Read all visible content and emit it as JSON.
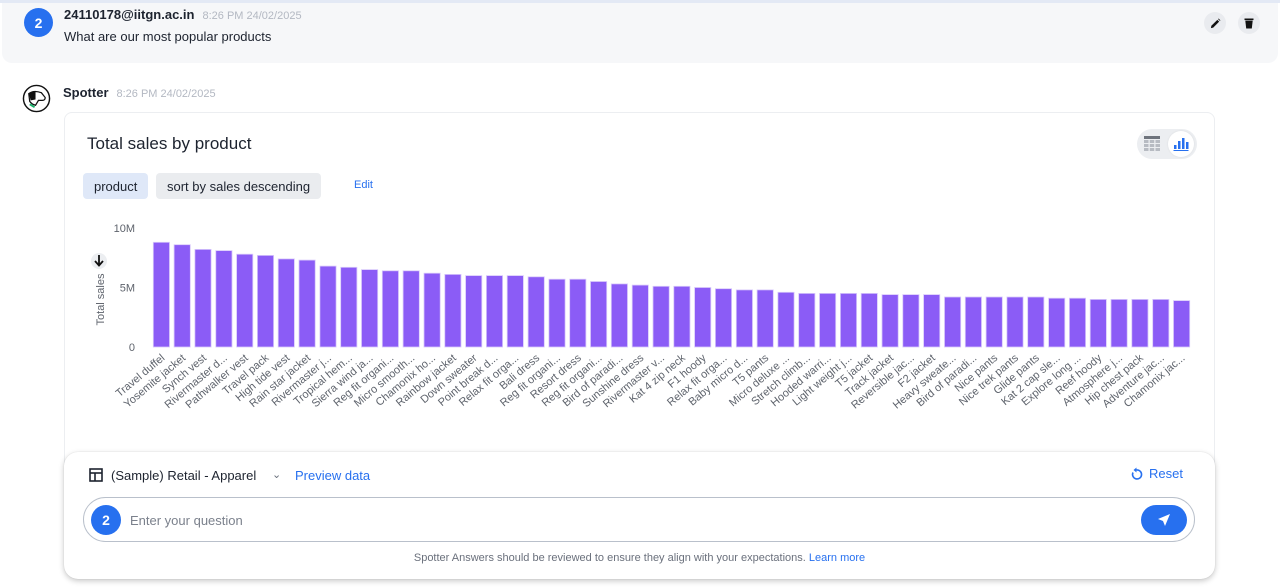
{
  "user_message": {
    "avatar_label": "2",
    "author": "24110178@iitgn.ac.in",
    "timestamp": "8:26 PM 24/02/2025",
    "text": "What are our most popular products",
    "actions": [
      "edit-icon",
      "delete-icon"
    ]
  },
  "spotter_message": {
    "author": "Spotter",
    "timestamp": "8:26 PM 24/02/2025"
  },
  "answer_card": {
    "title": "Total sales by product",
    "chips": [
      {
        "label": "product"
      },
      {
        "label": "sort by sales descending"
      }
    ],
    "edit_label": "Edit",
    "view_toggle": {
      "options": [
        "table-icon",
        "chart-icon"
      ],
      "selected": "chart-icon"
    },
    "sort_indicator": "arrow-down-icon"
  },
  "chart_data": {
    "type": "bar",
    "title": "Total sales by product",
    "xlabel": "",
    "ylabel": "Total sales",
    "ylim": [
      0,
      10000000
    ],
    "yticks": [
      {
        "value": 0,
        "label": "0"
      },
      {
        "value": 5000000,
        "label": "5M"
      },
      {
        "value": 10000000,
        "label": "10M"
      }
    ],
    "grid": false,
    "legend": "none",
    "bar_color": "#8b5cf6",
    "categories": [
      "Travel duffel",
      "Yosemite jacket",
      "Synch vest",
      "Rivermaster d...",
      "Pathwalker vest",
      "Travel pack",
      "High tide vest",
      "Rain star jacket",
      "Rivermaster j...",
      "Tropical hem...",
      "Sierra wind ja...",
      "Reg fit organi...",
      "Micro smooth...",
      "Chamonix ho...",
      "Rainbow jacket",
      "Down sweater",
      "Point break d...",
      "Relax fit orga...",
      "Bali dress",
      "Reg fit organi...",
      "Resort dress",
      "Reg fit organi...",
      "Bird of paradi...",
      "Sunshine dress",
      "Rivermaster v...",
      "Kat 4 zip neck",
      "F1 hoody",
      "Relax fit orga...",
      "Baby micro d...",
      "T5 pants",
      "Micro deluxe ...",
      "Stretch climb...",
      "Hooded warri...",
      "Light weight j...",
      "T5 jacket",
      "Track jacket",
      "Reversible jac...",
      "F2 jacket",
      "Heavy sweate...",
      "Bird of paradi...",
      "Nice pants",
      "Nice trek pants",
      "Glide pants",
      "Kat 2 cap sle...",
      "Explore long ...",
      "Reef hoody",
      "Atmosphere j...",
      "Hip chest pack",
      "Adventure jac...",
      "Chamonix jac..."
    ],
    "values": [
      8800000,
      8600000,
      8200000,
      8100000,
      7800000,
      7700000,
      7400000,
      7300000,
      6800000,
      6700000,
      6500000,
      6400000,
      6400000,
      6200000,
      6100000,
      6000000,
      6000000,
      6000000,
      5900000,
      5700000,
      5700000,
      5500000,
      5300000,
      5200000,
      5100000,
      5100000,
      5000000,
      4900000,
      4800000,
      4800000,
      4600000,
      4500000,
      4500000,
      4500000,
      4500000,
      4400000,
      4400000,
      4400000,
      4200000,
      4200000,
      4200000,
      4200000,
      4200000,
      4100000,
      4100000,
      4000000,
      4000000,
      4000000,
      4000000,
      3900000
    ]
  },
  "composer": {
    "datasource": "(Sample) Retail - Apparel",
    "preview_label": "Preview data",
    "reset_label": "Reset",
    "avatar_label": "2",
    "input_value": "",
    "input_placeholder": "Enter your question",
    "disclaimer": "Spotter Answers should be reviewed to ensure they align with your expectations.",
    "learn_more": "Learn more"
  },
  "colors": {
    "accent": "#2770ef",
    "bar": "#8b5cf6",
    "chip_selected": "#dfe8f8"
  }
}
